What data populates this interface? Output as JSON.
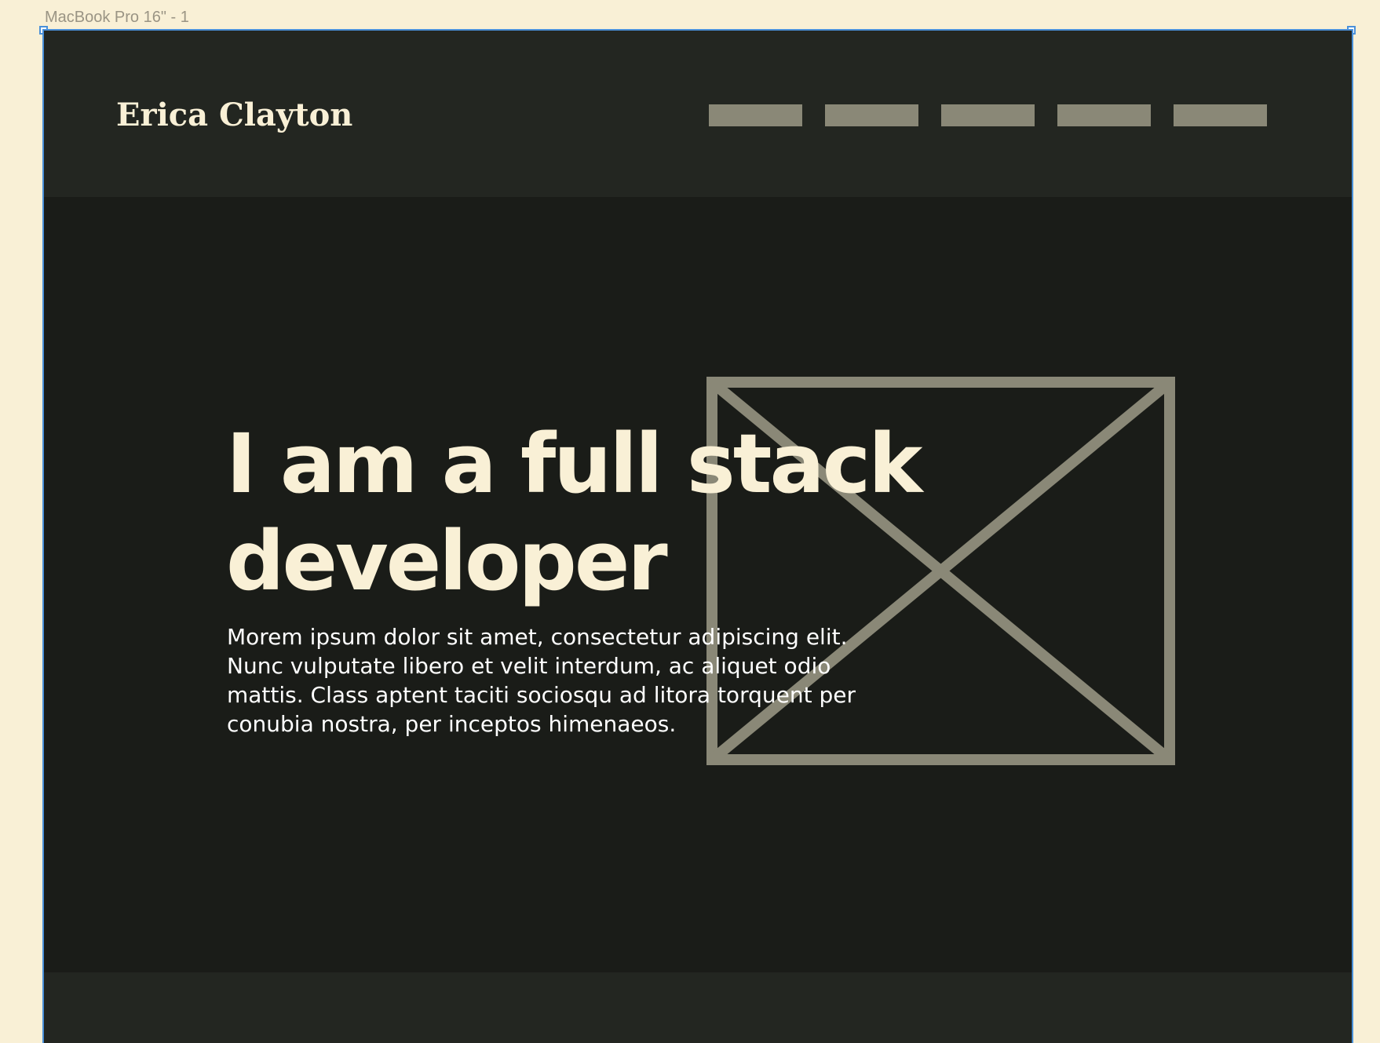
{
  "canvas": {
    "frame_label": "MacBook Pro 16\" - 1"
  },
  "header": {
    "logo": "Erica Clayton",
    "nav_items": [
      "",
      "",
      "",
      "",
      ""
    ]
  },
  "hero": {
    "title_lines": [
      "I am a full stack",
      "developer"
    ],
    "body_lines": [
      "Morem ipsum dolor sit amet, consectetur adipiscing elit.",
      "Nunc vulputate libero et velit interdum, ac aliquet odio",
      "mattis. Class aptent taciti sociosqu ad litora torquent per",
      "conubia nostra, per inceptos himenaeos."
    ],
    "image_placeholder_icon": "image-placeholder-icon"
  },
  "colors": {
    "canvas_bg": "#f9f0d6",
    "page_bg": "#1a1c18",
    "header_bg": "#232621",
    "accent_text": "#f9f0d6",
    "placeholder": "#8a8877",
    "selection": "#4a90d9"
  }
}
